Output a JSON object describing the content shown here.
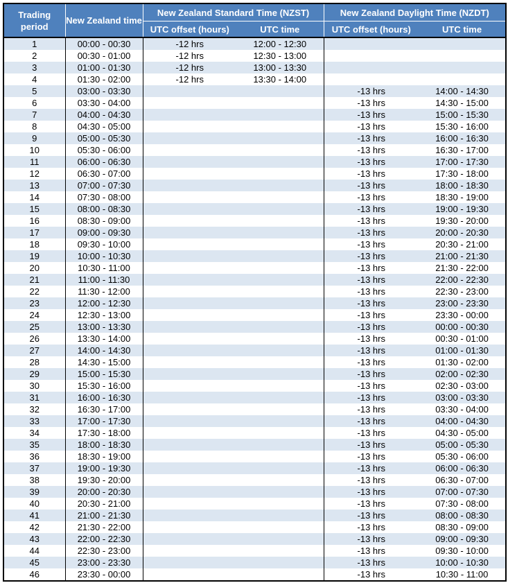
{
  "header": {
    "trading_period": "Trading period",
    "nz_time": "New Zealand time",
    "nzst_group": "New Zealand Standard Time (NZST)",
    "nzdt_group": "New Zealand Daylight Time (NZDT)",
    "nzst_offset": "UTC offset (hours)",
    "nzst_utc": "UTC time",
    "nzdt_offset": "UTC offset (hours)",
    "nzdt_utc": "UTC time"
  },
  "colors": {
    "header_bg": "#4f81bd",
    "header_text": "#ffffff",
    "band_row": "#dce6f1",
    "border": "#000000"
  },
  "rows": [
    {
      "period": "1",
      "nz": "00:00 - 00:30",
      "st_off": "-12 hrs",
      "st_utc": "12:00 - 12:30",
      "dt_off": "",
      "dt_utc": ""
    },
    {
      "period": "2",
      "nz": "00:30 - 01:00",
      "st_off": "-12 hrs",
      "st_utc": "12:30 - 13:00",
      "dt_off": "",
      "dt_utc": ""
    },
    {
      "period": "3",
      "nz": "01:00 - 01:30",
      "st_off": "-12 hrs",
      "st_utc": "13:00 - 13:30",
      "dt_off": "",
      "dt_utc": ""
    },
    {
      "period": "4",
      "nz": "01:30 - 02:00",
      "st_off": "-12 hrs",
      "st_utc": "13:30 - 14:00",
      "dt_off": "",
      "dt_utc": ""
    },
    {
      "period": "5",
      "nz": "03:00 - 03:30",
      "st_off": "",
      "st_utc": "",
      "dt_off": "-13 hrs",
      "dt_utc": "14:00 - 14:30"
    },
    {
      "period": "6",
      "nz": "03:30 - 04:00",
      "st_off": "",
      "st_utc": "",
      "dt_off": "-13 hrs",
      "dt_utc": "14:30 - 15:00"
    },
    {
      "period": "7",
      "nz": "04:00 - 04:30",
      "st_off": "",
      "st_utc": "",
      "dt_off": "-13 hrs",
      "dt_utc": "15:00 - 15:30"
    },
    {
      "period": "8",
      "nz": "04:30 - 05:00",
      "st_off": "",
      "st_utc": "",
      "dt_off": "-13 hrs",
      "dt_utc": "15:30 - 16:00"
    },
    {
      "period": "9",
      "nz": "05:00 - 05:30",
      "st_off": "",
      "st_utc": "",
      "dt_off": "-13 hrs",
      "dt_utc": "16:00 - 16:30"
    },
    {
      "period": "10",
      "nz": "05:30 - 06:00",
      "st_off": "",
      "st_utc": "",
      "dt_off": "-13 hrs",
      "dt_utc": "16:30 - 17:00"
    },
    {
      "period": "11",
      "nz": "06:00 - 06:30",
      "st_off": "",
      "st_utc": "",
      "dt_off": "-13 hrs",
      "dt_utc": "17:00 - 17:30"
    },
    {
      "period": "12",
      "nz": "06:30 - 07:00",
      "st_off": "",
      "st_utc": "",
      "dt_off": "-13 hrs",
      "dt_utc": "17:30 - 18:00"
    },
    {
      "period": "13",
      "nz": "07:00 - 07:30",
      "st_off": "",
      "st_utc": "",
      "dt_off": "-13 hrs",
      "dt_utc": "18:00 - 18:30"
    },
    {
      "period": "14",
      "nz": "07:30 - 08:00",
      "st_off": "",
      "st_utc": "",
      "dt_off": "-13 hrs",
      "dt_utc": "18:30 - 19:00"
    },
    {
      "period": "15",
      "nz": "08:00 - 08:30",
      "st_off": "",
      "st_utc": "",
      "dt_off": "-13 hrs",
      "dt_utc": "19:00 - 19:30"
    },
    {
      "period": "16",
      "nz": "08:30 - 09:00",
      "st_off": "",
      "st_utc": "",
      "dt_off": "-13 hrs",
      "dt_utc": "19:30 - 20:00"
    },
    {
      "period": "17",
      "nz": "09:00 - 09:30",
      "st_off": "",
      "st_utc": "",
      "dt_off": "-13 hrs",
      "dt_utc": "20:00 - 20:30"
    },
    {
      "period": "18",
      "nz": "09:30 - 10:00",
      "st_off": "",
      "st_utc": "",
      "dt_off": "-13 hrs",
      "dt_utc": "20:30 - 21:00"
    },
    {
      "period": "19",
      "nz": "10:00 - 10:30",
      "st_off": "",
      "st_utc": "",
      "dt_off": "-13 hrs",
      "dt_utc": "21:00 - 21:30"
    },
    {
      "period": "20",
      "nz": "10:30 - 11:00",
      "st_off": "",
      "st_utc": "",
      "dt_off": "-13 hrs",
      "dt_utc": "21:30 - 22:00"
    },
    {
      "period": "21",
      "nz": "11:00 - 11:30",
      "st_off": "",
      "st_utc": "",
      "dt_off": "-13 hrs",
      "dt_utc": "22:00 - 22:30"
    },
    {
      "period": "22",
      "nz": "11:30 - 12:00",
      "st_off": "",
      "st_utc": "",
      "dt_off": "-13 hrs",
      "dt_utc": "22:30 - 23:00"
    },
    {
      "period": "23",
      "nz": "12:00 - 12:30",
      "st_off": "",
      "st_utc": "",
      "dt_off": "-13 hrs",
      "dt_utc": "23:00 - 23:30"
    },
    {
      "period": "24",
      "nz": "12:30 - 13:00",
      "st_off": "",
      "st_utc": "",
      "dt_off": "-13 hrs",
      "dt_utc": "23:30 - 00:00"
    },
    {
      "period": "25",
      "nz": "13:00 - 13:30",
      "st_off": "",
      "st_utc": "",
      "dt_off": "-13 hrs",
      "dt_utc": "00:00 - 00:30"
    },
    {
      "period": "26",
      "nz": "13:30 - 14:00",
      "st_off": "",
      "st_utc": "",
      "dt_off": "-13 hrs",
      "dt_utc": "00:30 - 01:00"
    },
    {
      "period": "27",
      "nz": "14:00 - 14:30",
      "st_off": "",
      "st_utc": "",
      "dt_off": "-13 hrs",
      "dt_utc": "01:00 - 01:30"
    },
    {
      "period": "28",
      "nz": "14:30 - 15:00",
      "st_off": "",
      "st_utc": "",
      "dt_off": "-13 hrs",
      "dt_utc": "01:30 - 02:00"
    },
    {
      "period": "29",
      "nz": "15:00 - 15:30",
      "st_off": "",
      "st_utc": "",
      "dt_off": "-13 hrs",
      "dt_utc": "02:00 - 02:30"
    },
    {
      "period": "30",
      "nz": "15:30 - 16:00",
      "st_off": "",
      "st_utc": "",
      "dt_off": "-13 hrs",
      "dt_utc": "02:30 - 03:00"
    },
    {
      "period": "31",
      "nz": "16:00 - 16:30",
      "st_off": "",
      "st_utc": "",
      "dt_off": "-13 hrs",
      "dt_utc": "03:00 - 03:30"
    },
    {
      "period": "32",
      "nz": "16:30 - 17:00",
      "st_off": "",
      "st_utc": "",
      "dt_off": "-13 hrs",
      "dt_utc": "03:30 - 04:00"
    },
    {
      "period": "33",
      "nz": "17:00 - 17:30",
      "st_off": "",
      "st_utc": "",
      "dt_off": "-13 hrs",
      "dt_utc": "04:00 - 04:30"
    },
    {
      "period": "34",
      "nz": "17:30 - 18:00",
      "st_off": "",
      "st_utc": "",
      "dt_off": "-13 hrs",
      "dt_utc": "04:30 - 05:00"
    },
    {
      "period": "35",
      "nz": "18:00 - 18:30",
      "st_off": "",
      "st_utc": "",
      "dt_off": "-13 hrs",
      "dt_utc": "05:00 - 05:30"
    },
    {
      "period": "36",
      "nz": "18:30 - 19:00",
      "st_off": "",
      "st_utc": "",
      "dt_off": "-13 hrs",
      "dt_utc": "05:30 - 06:00"
    },
    {
      "period": "37",
      "nz": "19:00 - 19:30",
      "st_off": "",
      "st_utc": "",
      "dt_off": "-13 hrs",
      "dt_utc": "06:00 - 06:30"
    },
    {
      "period": "38",
      "nz": "19:30 - 20:00",
      "st_off": "",
      "st_utc": "",
      "dt_off": "-13 hrs",
      "dt_utc": "06:30 - 07:00"
    },
    {
      "period": "39",
      "nz": "20:00 - 20:30",
      "st_off": "",
      "st_utc": "",
      "dt_off": "-13 hrs",
      "dt_utc": "07:00 - 07:30"
    },
    {
      "period": "40",
      "nz": "20:30 - 21:00",
      "st_off": "",
      "st_utc": "",
      "dt_off": "-13 hrs",
      "dt_utc": "07:30 - 08:00"
    },
    {
      "period": "41",
      "nz": "21:00 - 21:30",
      "st_off": "",
      "st_utc": "",
      "dt_off": "-13 hrs",
      "dt_utc": "08:00 - 08:30"
    },
    {
      "period": "42",
      "nz": "21:30 - 22:00",
      "st_off": "",
      "st_utc": "",
      "dt_off": "-13 hrs",
      "dt_utc": "08:30 - 09:00"
    },
    {
      "period": "43",
      "nz": "22:00 - 22:30",
      "st_off": "",
      "st_utc": "",
      "dt_off": "-13 hrs",
      "dt_utc": "09:00 - 09:30"
    },
    {
      "period": "44",
      "nz": "22:30 - 23:00",
      "st_off": "",
      "st_utc": "",
      "dt_off": "-13 hrs",
      "dt_utc": "09:30 - 10:00"
    },
    {
      "period": "45",
      "nz": "23:00 - 23:30",
      "st_off": "",
      "st_utc": "",
      "dt_off": "-13 hrs",
      "dt_utc": "10:00 - 10:30"
    },
    {
      "period": "46",
      "nz": "23:30 - 00:00",
      "st_off": "",
      "st_utc": "",
      "dt_off": "-13 hrs",
      "dt_utc": "10:30 - 11:00"
    }
  ]
}
